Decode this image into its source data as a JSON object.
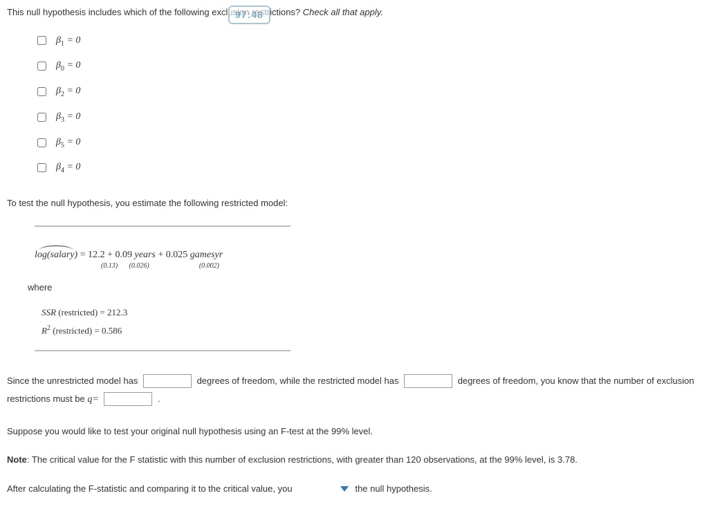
{
  "timer": "97:48",
  "q1": {
    "prompt_a": "This null hypothesis includes which of the following exclusion restrictions? ",
    "prompt_b": "Check all that apply.",
    "options": [
      {
        "sub": "1"
      },
      {
        "sub": "0"
      },
      {
        "sub": "2"
      },
      {
        "sub": "3"
      },
      {
        "sub": "5"
      },
      {
        "sub": "4"
      }
    ]
  },
  "restricted_intro": "To test the null hypothesis, you estimate the following restricted model:",
  "equation": {
    "lhs": "log(salary)",
    "c0": "12.2",
    "se0": "(0.13)",
    "c1": "0.09",
    "v1": "years",
    "se1": "(0.026)",
    "c2": "0.025",
    "v2": "gamesyr",
    "se2": "(0.002)"
  },
  "where": "where",
  "ssr": {
    "line1a": "SSR",
    "line1b": " (restricted) = 212.3",
    "line2a": "R",
    "line2b": "  (restricted) = 0.586"
  },
  "dof": {
    "p1": "Since the unrestricted model has ",
    "p2": " degrees of freedom, while the restricted model has ",
    "p3": " degrees of freedom, you know that the number of exclusion restrictions must be ",
    "qlabel": "q="
  },
  "ftest": "Suppose you would like to test your original null hypothesis using an F-test at the 99% level.",
  "note_label": "Note",
  "note_text": ": The critical value for the F statistic with this number of exclusion restrictions, with greater than 120 observations, at the 99% level, is 3.78.",
  "conclusion": {
    "p1": "After calculating the F-statistic and comparing it to the critical value, you ",
    "p2": " the null hypothesis."
  }
}
